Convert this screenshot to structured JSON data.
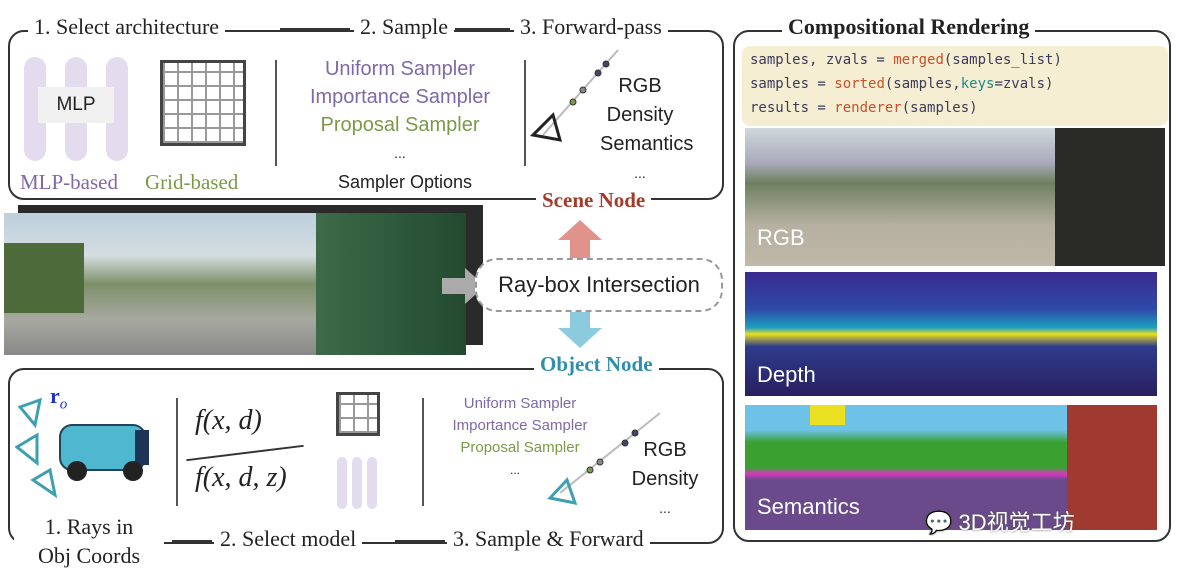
{
  "scene": {
    "step1": "1. Select architecture",
    "step2": "2. Sample",
    "step3": "3. Forward-pass",
    "mlp": "MLP",
    "mlp_based": "MLP-based",
    "grid_based": "Grid-based",
    "samplers": [
      "Uniform Sampler",
      "Importance Sampler",
      "Proposal Sampler",
      "..."
    ],
    "sampler_options": "Sampler Options",
    "outputs": [
      "RGB",
      "Density",
      "Semantics",
      "..."
    ],
    "node": "Scene Node"
  },
  "middle": {
    "intersection": "Ray-box Intersection"
  },
  "object": {
    "node": "Object Node",
    "ray_label": "r",
    "ray_sub": "o",
    "f1": "f(x, d)",
    "f2": "f(x, d, z)",
    "samplers": [
      "Uniform Sampler",
      "Importance Sampler",
      "Proposal Sampler",
      "..."
    ],
    "outputs": [
      "RGB",
      "Density",
      "..."
    ],
    "step1a": "1. Rays in",
    "step1b": "Obj Coords",
    "step2": "2. Select model",
    "step3": "3. Sample & Forward"
  },
  "render": {
    "title": "Compositional Rendering",
    "code": [
      [
        "samples, zvals = ",
        "merged",
        "(samples_list)"
      ],
      [
        "samples = ",
        "sorted",
        "(samples,",
        "keys",
        "=zvals)"
      ],
      [
        "results = ",
        "renderer",
        "(samples)"
      ]
    ],
    "rgb": "RGB",
    "depth": "Depth",
    "semantics": "Semantics"
  },
  "watermark": "3D视觉工坊",
  "colors": {
    "scene_node": "#a33a2a",
    "object_node": "#2f8fa8",
    "purple": "#7e69a8",
    "green": "#7a9a48",
    "code_bg": "#f5eed2"
  }
}
